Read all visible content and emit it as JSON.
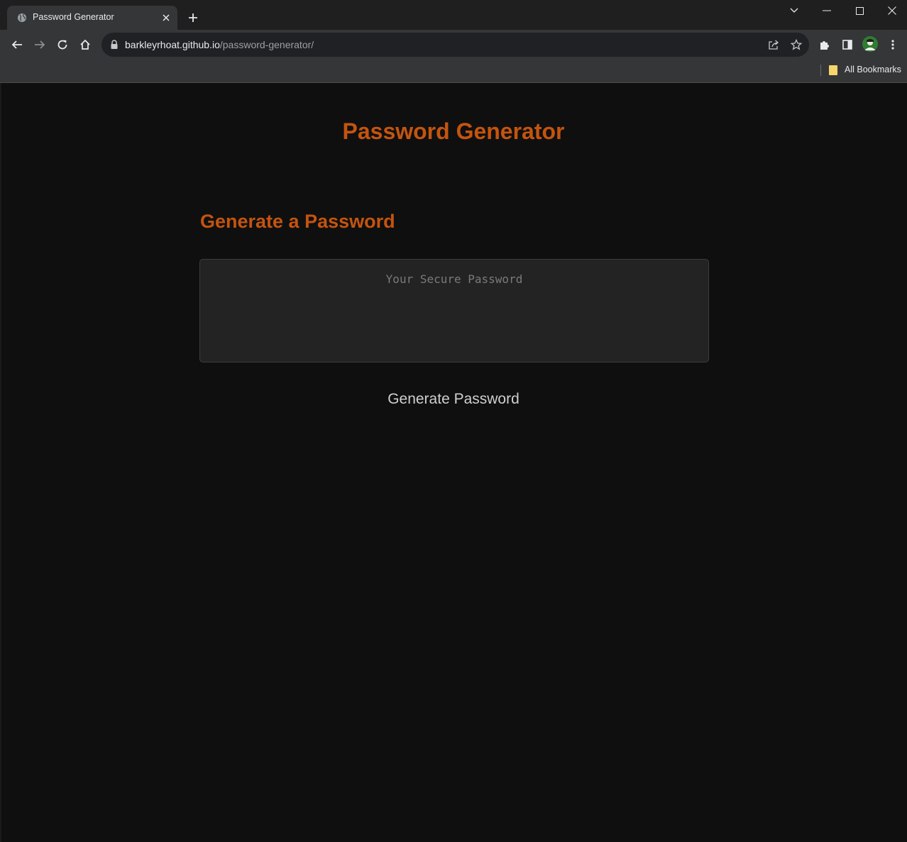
{
  "browser": {
    "tab": {
      "title": "Password Generator"
    },
    "address_bar": {
      "host": "barkleyrhoat.github.io",
      "path": "/password-generator/"
    },
    "bookmarks_bar": {
      "all_bookmarks_label": "All Bookmarks"
    }
  },
  "page": {
    "title": "Password Generator",
    "card": {
      "heading": "Generate a Password",
      "password_placeholder": "Your Secure Password",
      "password_value": "",
      "generate_button_label": "Generate Password"
    }
  },
  "colors": {
    "accent": "#c4540f",
    "page_background": "#0f0f0f",
    "input_background": "#232323"
  }
}
